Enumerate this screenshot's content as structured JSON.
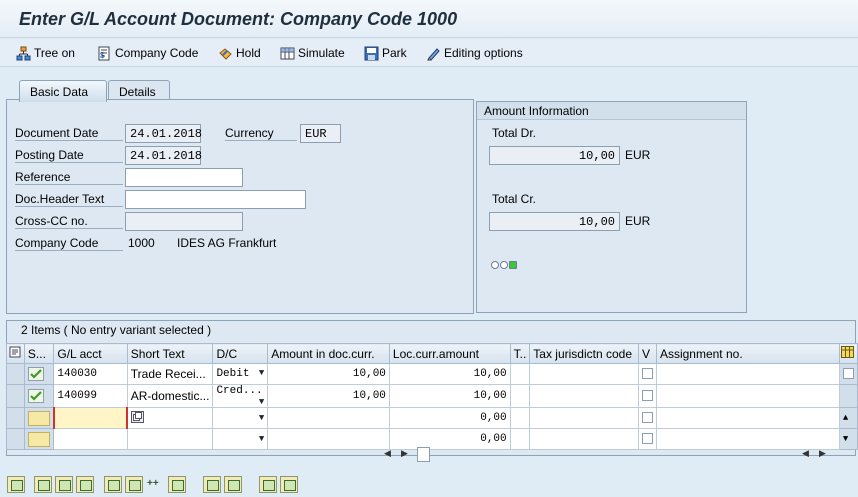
{
  "window": {
    "title": "Enter G/L Account Document: Company Code 1000"
  },
  "toolbar": {
    "tree_on": "Tree on",
    "company_code": "Company Code",
    "hold": "Hold",
    "simulate": "Simulate",
    "park": "Park",
    "editing_options": "Editing options"
  },
  "tabs": {
    "basic_data": "Basic Data",
    "details": "Details"
  },
  "basic": {
    "document_date_label": "Document Date",
    "document_date": "24.01.2018",
    "currency_label": "Currency",
    "currency": "EUR",
    "posting_date_label": "Posting Date",
    "posting_date": "24.01.2018",
    "reference_label": "Reference",
    "reference": "",
    "doc_header_label": "Doc.Header Text",
    "doc_header": "",
    "cross_cc_label": "Cross-CC no.",
    "cross_cc": "",
    "company_code_label": "Company Code",
    "company_code": "1000",
    "company_name": "IDES AG Frankfurt"
  },
  "amount_info": {
    "title": "Amount Information",
    "total_dr_label": "Total Dr.",
    "total_dr": "10,00",
    "total_dr_curr": "EUR",
    "total_cr_label": "Total Cr.",
    "total_cr": "10,00",
    "total_cr_curr": "EUR",
    "status": "balanced"
  },
  "items": {
    "title": "2 Items ( No entry variant selected )",
    "columns": {
      "status": "S...",
      "gl_acct": "G/L acct",
      "short_text": "Short Text",
      "dc": "D/C",
      "amount_doc": "Amount in doc.curr.",
      "amount_loc": "Loc.curr.amount",
      "t": "T..",
      "tax_juris": "Tax jurisdictn code",
      "v": "V",
      "assignment": "Assignment no."
    },
    "rows": [
      {
        "gl_acct": "140030",
        "short_text": "Trade Recei...",
        "dc": "Debit",
        "amount_doc": "10,00",
        "amount_loc": "10,00"
      },
      {
        "gl_acct": "140099",
        "short_text": "AR-domestic...",
        "dc": "Cred...",
        "amount_doc": "10,00",
        "amount_loc": "10,00"
      },
      {
        "gl_acct": "",
        "short_text": "",
        "dc": "",
        "amount_doc": "",
        "amount_loc": "0,00"
      },
      {
        "gl_acct": "",
        "short_text": "",
        "dc": "",
        "amount_doc": "",
        "amount_loc": "0,00"
      }
    ]
  }
}
